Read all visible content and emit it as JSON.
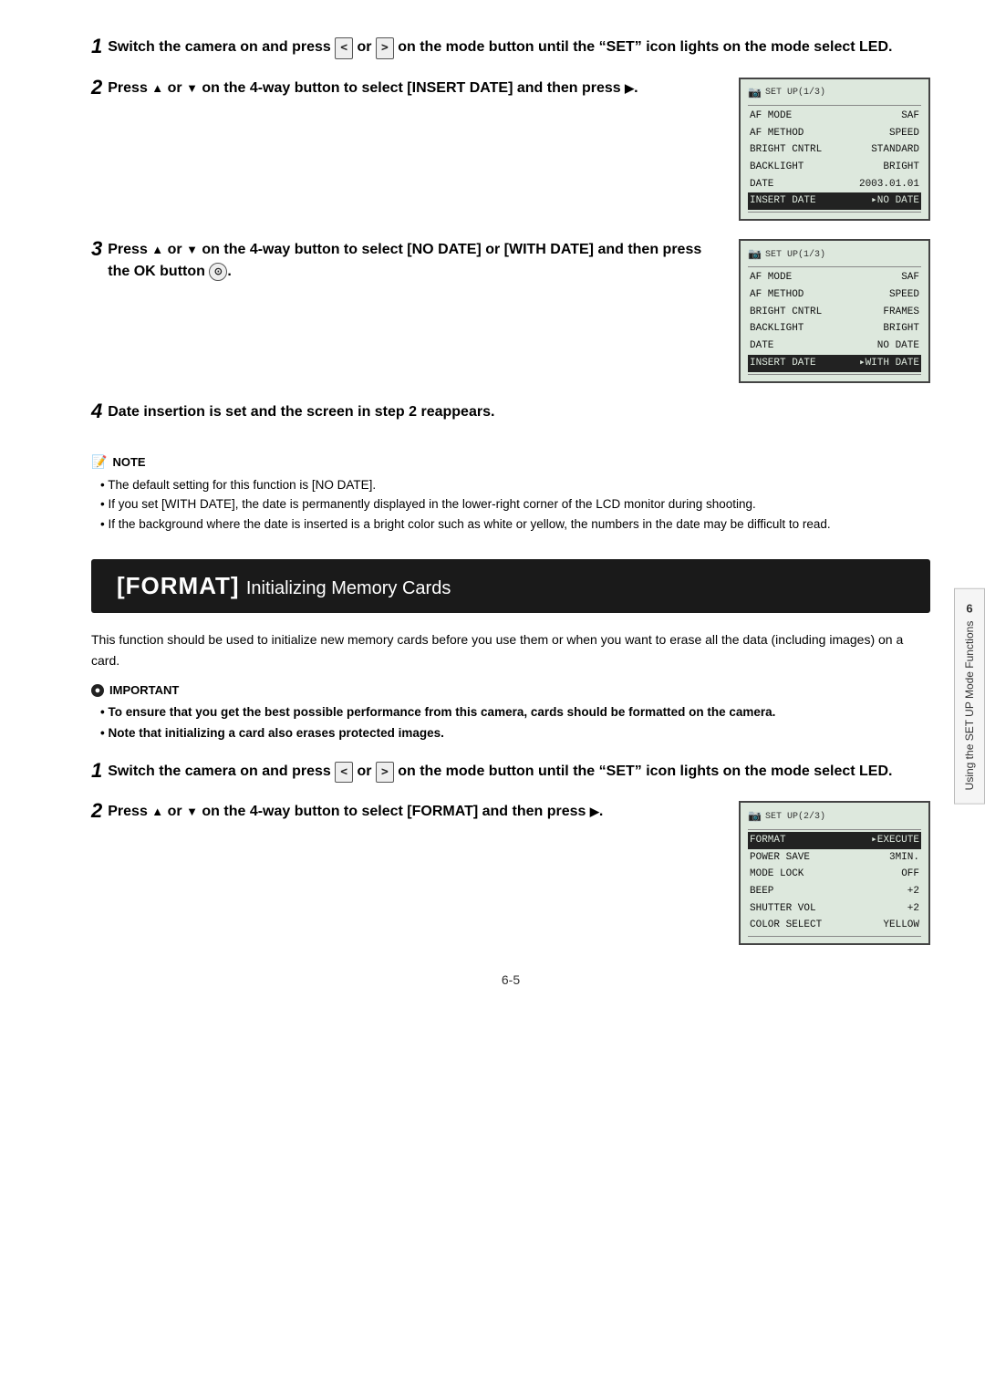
{
  "page": {
    "number": "6-5",
    "sidebar_label": "Using the SET UP Mode Functions",
    "sidebar_num": "6"
  },
  "section_insert_date": {
    "step1": {
      "num": "1",
      "text_parts": [
        "Switch the camera on and press ",
        " or ",
        " on the mode button until the “",
        "” icon lights on the mode select LED."
      ],
      "btn_left": "<",
      "btn_right": ">",
      "icon_set": "SET"
    },
    "step2": {
      "num": "2",
      "text": "Press ▲ or ▼ on the 4-way button to select [INSERT DATE] and then press ▶.",
      "lcd": {
        "title": "SET UP(1/3)",
        "rows": [
          {
            "label": "AF MODE",
            "value": "SAF"
          },
          {
            "label": "AF METHOD",
            "value": "SPEED"
          },
          {
            "label": "BRIGHT CNTRL",
            "value": "STANDARD"
          },
          {
            "label": "BACKLIGHT",
            "value": "BRIGHT"
          },
          {
            "label": "DATE",
            "value": "2003.01.01"
          },
          {
            "label": "INSERT DATE",
            "value": "NO DATE",
            "highlight": true
          }
        ]
      }
    },
    "step3": {
      "num": "3",
      "text": "Press ▲ or ▼ on the 4-way button to select [NO DATE] or [WITH DATE] and then press the OK button.",
      "lcd": {
        "title": "SET UP(1/3)",
        "rows": [
          {
            "label": "AF MODE",
            "value": "SAF"
          },
          {
            "label": "AF METHOD",
            "value": "SPEED"
          },
          {
            "label": "BRIGHT CNTRL",
            "value": "FRAMES"
          },
          {
            "label": "BACKLIGHT",
            "value": "BRIGHT"
          },
          {
            "label": "DATE",
            "value": "NO DATE"
          },
          {
            "label": "INSERT DATE",
            "value": "WITH DATE",
            "highlight": true
          }
        ]
      }
    },
    "step4": {
      "num": "4",
      "text": "Date insertion is set and the screen in step 2 reappears."
    },
    "note": {
      "header": "NOTE",
      "items": [
        "The default setting for this function is [NO DATE].",
        "If you set [WITH DATE], the date is permanently displayed in the lower-right corner of the LCD monitor during shooting.",
        "If the background where the date is inserted is a bright color such as white or yellow, the numbers in the date may be difficult to read."
      ]
    }
  },
  "section_format": {
    "banner_bracket": "[FORMAT]",
    "banner_text": "Initializing Memory Cards",
    "description": "This function should be used to initialize new memory cards before you use them or when you want to erase all the data (including images) on a card.",
    "important": {
      "header": "IMPORTANT",
      "items": [
        "To ensure that you get the best possible performance from this camera, cards should be formatted on the camera.",
        "Note that initializing a card also erases protected images."
      ]
    },
    "step1": {
      "num": "1",
      "text_parts": [
        "Switch the camera on and press ",
        " or ",
        " on the mode button until the “",
        "” icon lights on the mode select LED."
      ],
      "btn_left": "<",
      "btn_right": ">"
    },
    "step2": {
      "num": "2",
      "text": "Press ▲ or ▼ on the 4-way button to select [FORMAT] and then press ▶.",
      "lcd": {
        "title": "SET UP(2/3)",
        "rows": [
          {
            "label": "FORMAT",
            "value": "EXECUTE",
            "highlight": true
          },
          {
            "label": "POWER SAVE",
            "value": "3MIN."
          },
          {
            "label": "MODE LOCK",
            "value": "OFF"
          },
          {
            "label": "BEEP",
            "value": "+2"
          },
          {
            "label": "SHUTTER VOL",
            "value": "+2"
          },
          {
            "label": "COLOR SELECT",
            "value": "YELLOW"
          }
        ]
      }
    }
  }
}
